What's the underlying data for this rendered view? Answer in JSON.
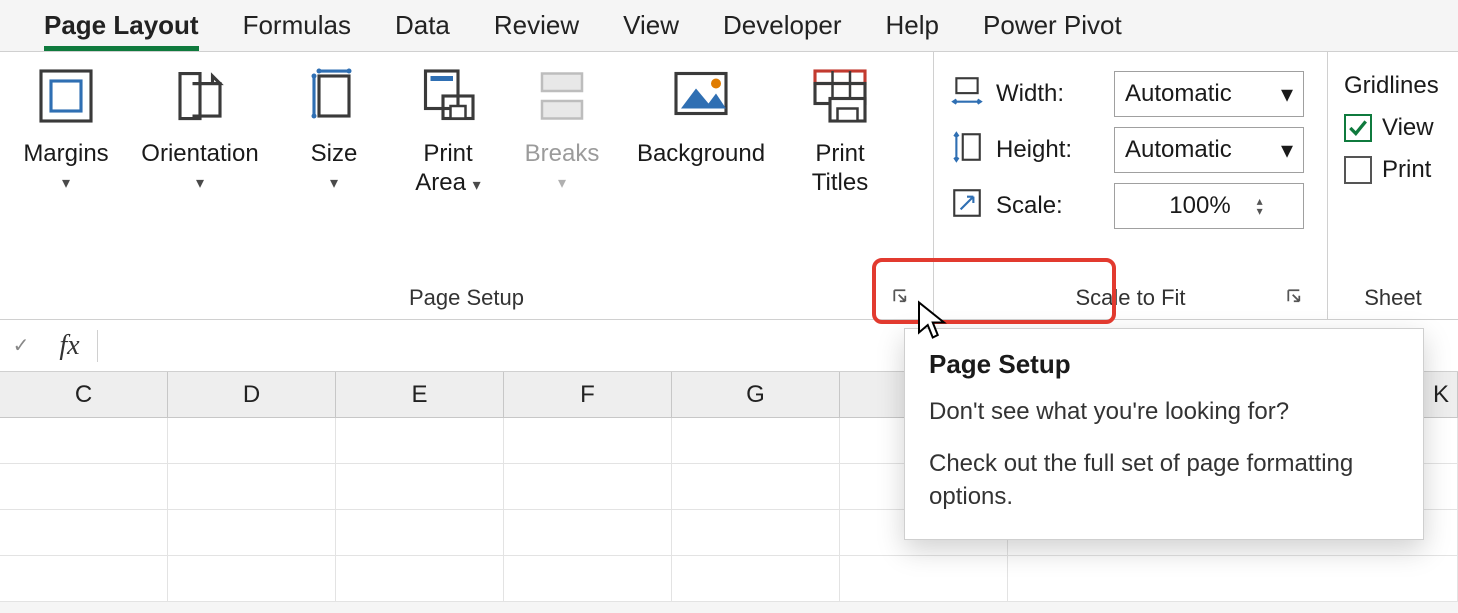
{
  "tabs": {
    "page_layout": "Page Layout",
    "formulas": "Formulas",
    "data": "Data",
    "review": "Review",
    "view": "View",
    "developer": "Developer",
    "help": "Help",
    "power_pivot": "Power Pivot"
  },
  "ribbon": {
    "page_setup": {
      "margins": "Margins",
      "orientation": "Orientation",
      "size": "Size",
      "print_area_1": "Print",
      "print_area_2": "Area",
      "breaks": "Breaks",
      "background": "Background",
      "print_titles_1": "Print",
      "print_titles_2": "Titles",
      "group_label": "Page Setup"
    },
    "scale_to_fit": {
      "width_label": "Width:",
      "width_value": "Automatic",
      "height_label": "Height:",
      "height_value": "Automatic",
      "scale_label": "Scale:",
      "scale_value": "100%",
      "group_label": "Scale to Fit"
    },
    "sheet_options": {
      "gridlines": "Gridlines",
      "view": "View",
      "print": "Print",
      "group_label": "Sheet"
    }
  },
  "formula_bar": {
    "fx": "fx",
    "value": ""
  },
  "columns": [
    "C",
    "D",
    "E",
    "F",
    "G",
    "",
    "K"
  ],
  "tooltip": {
    "title": "Page Setup",
    "line1": "Don't see what you're looking for?",
    "line2": "Check out the full set of page formatting options."
  }
}
